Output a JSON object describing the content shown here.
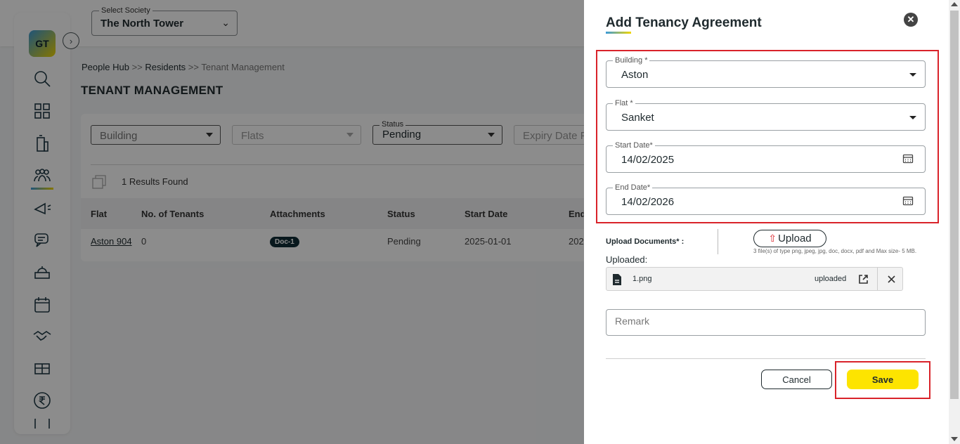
{
  "header": {
    "society_label": "Select Society",
    "society_value": "The North Tower"
  },
  "sidebar": {
    "logo_text": "GT",
    "items": [
      "search-icon",
      "dashboard-icon",
      "building-icon",
      "residents-icon",
      "broadcast-icon",
      "chat-icon",
      "helpdesk-icon",
      "calendar-icon",
      "handshake-icon",
      "amenities-icon",
      "rupee-icon",
      "checklist-icon"
    ]
  },
  "breadcrumb": {
    "item1": "People Hub",
    "sep1": " >> ",
    "item2": "Residents",
    "sep2": " >> ",
    "item3": "Tenant Management"
  },
  "page_title": "TENANT MANAGEMENT",
  "filters": {
    "building": "Building",
    "flats": "Flats",
    "status_label": "Status",
    "status_value": "Pending",
    "expiry": "Expiry Date F"
  },
  "results_text": "1 Results Found",
  "table": {
    "headers": [
      "Flat",
      "No. of Tenants",
      "Attachments",
      "Status",
      "Start Date",
      "End"
    ],
    "row": {
      "flat": "Aston 904",
      "tenants": "0",
      "attachment": "Doc-1",
      "status": "Pending",
      "start_date": "2025-01-01",
      "end_date": "202"
    }
  },
  "drawer": {
    "title": "Add Tenancy Agreement",
    "building_label": "Building *",
    "building_value": "Aston",
    "flat_label": "Flat *",
    "flat_value": "Sanket",
    "start_label": "Start Date*",
    "start_value": "14/02/2025",
    "end_label": "End Date*",
    "end_value": "14/02/2026",
    "upload_label": "Upload Documents* :",
    "upload_button": "Upload",
    "upload_hint": "3 file(s) of type png, jpeg, jpg, doc, docx, pdf and Max size- 5 MB.",
    "uploaded_label": "Uploaded:",
    "file_name": "1.png",
    "file_status": "uploaded",
    "remark_placeholder": "Remark",
    "cancel": "Cancel",
    "save": "Save"
  },
  "colors": {
    "accent_yellow": "#fde400",
    "highlight_red": "#d9232a",
    "dark": "#1f2a2e"
  }
}
